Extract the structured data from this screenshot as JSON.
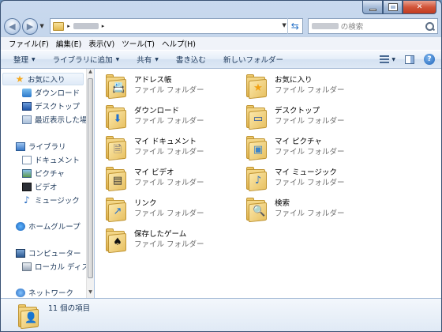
{
  "address": {
    "placeholder_name": "",
    "separator": "▸"
  },
  "search": {
    "suffix": "の検索"
  },
  "menu": [
    "ファイル(F)",
    "編集(E)",
    "表示(V)",
    "ツール(T)",
    "ヘルプ(H)"
  ],
  "commands": {
    "organize": "整理",
    "add_library": "ライブラリに追加",
    "share": "共有",
    "burn": "書き込む",
    "new_folder": "新しいフォルダー"
  },
  "nav": {
    "favorites": "お気に入り",
    "downloads": "ダウンロード",
    "desktop": "デスクトップ",
    "recent": "最近表示した場所",
    "libraries": "ライブラリ",
    "documents": "ドキュメント",
    "pictures": "ピクチャ",
    "videos": "ビデオ",
    "music": "ミュージック",
    "homegroup": "ホームグループ",
    "computer": "コンピューター",
    "local_disk": "ローカル ディスク",
    "network": "ネットワーク"
  },
  "folder_type": "ファイル フォルダー",
  "items": [
    {
      "name": "アドレス帳",
      "badge": "📇"
    },
    {
      "name": "お気に入り",
      "badge": "★"
    },
    {
      "name": "ダウンロード",
      "badge": "⬇"
    },
    {
      "name": "デスクトップ",
      "badge": "▭"
    },
    {
      "name": "マイ ドキュメント",
      "badge": "🗎"
    },
    {
      "name": "マイ ピクチャ",
      "badge": "▣"
    },
    {
      "name": "マイ ビデオ",
      "badge": "▤"
    },
    {
      "name": "マイ ミュージック",
      "badge": "♪"
    },
    {
      "name": "リンク",
      "badge": "↗"
    },
    {
      "name": "検索",
      "badge": "🔍"
    },
    {
      "name": "保存したゲーム",
      "badge": "♠"
    }
  ],
  "status": {
    "count_text": "11 個の項目"
  },
  "colors": {
    "accent": "#1e395b",
    "window_frame": "#b8cde6",
    "folder": "#e8c163"
  }
}
